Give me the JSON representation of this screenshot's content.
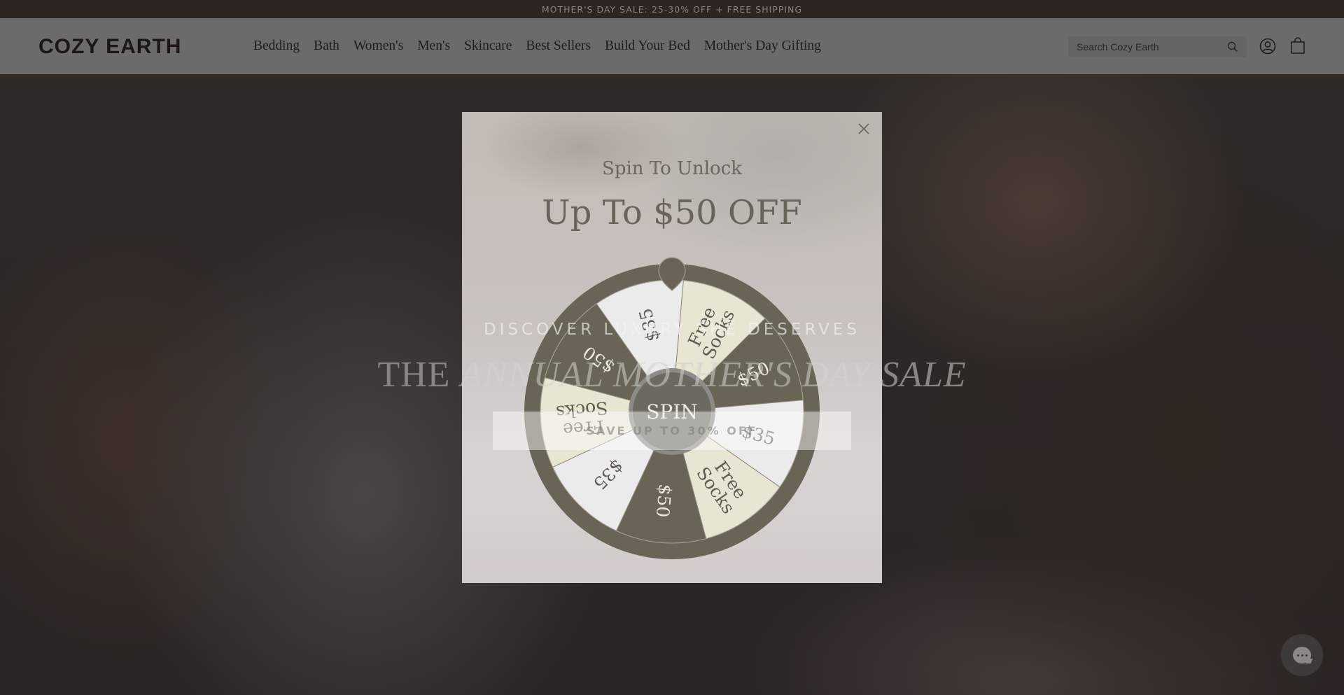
{
  "announcement": {
    "text": "MOTHER'S DAY SALE: 25-30% OFF  + FREE SHIPPING"
  },
  "header": {
    "logo": "COZY EARTH",
    "nav": [
      {
        "label": "Bedding"
      },
      {
        "label": "Bath"
      },
      {
        "label": "Women's"
      },
      {
        "label": "Men's"
      },
      {
        "label": "Skincare"
      },
      {
        "label": "Best Sellers"
      },
      {
        "label": "Build Your Bed"
      },
      {
        "label": "Mother's Day Gifting"
      }
    ],
    "search": {
      "placeholder": "Search Cozy Earth",
      "value": "",
      "icon": "search-icon"
    },
    "account_icon": "account-icon",
    "cart_icon": "cart-icon"
  },
  "hero": {
    "kicker": "DISCOVER LUXURY SHE DESERVES",
    "title_plain": "THE ",
    "title_italic": "ANNUAL MOTHER'S DAY SALE",
    "cta": "SAVE UP TO 30% OFF"
  },
  "modal": {
    "close_icon": "close-icon",
    "kicker": "Spin To Unlock",
    "title": "Up To $50 OFF",
    "wheel": {
      "spin_label": "SPIN",
      "segments": [
        {
          "label": "$35",
          "lines": [
            "$35"
          ],
          "color": "#ecebeb",
          "text_color": "#5f5a52"
        },
        {
          "label": "Free Socks",
          "lines": [
            "Free",
            "Socks"
          ],
          "color": "#e8e5d3",
          "text_color": "#5f5a52"
        },
        {
          "label": "$50",
          "lines": [
            "$50"
          ],
          "color": "#6a6457",
          "text_color": "#ece8df"
        },
        {
          "label": "$35",
          "lines": [
            "$35"
          ],
          "color": "#ecebeb",
          "text_color": "#5f5a52"
        },
        {
          "label": "Free Socks",
          "lines": [
            "Free",
            "Socks"
          ],
          "color": "#e8e5d3",
          "text_color": "#5f5a52"
        },
        {
          "label": "$50",
          "lines": [
            "$50"
          ],
          "color": "#6a6457",
          "text_color": "#ece8df"
        },
        {
          "label": "$35",
          "lines": [
            "$35"
          ],
          "color": "#ecebeb",
          "text_color": "#5f5a52"
        },
        {
          "label": "Free Socks",
          "lines": [
            "Free",
            "Socks"
          ],
          "color": "#e8e5d3",
          "text_color": "#5f5a52"
        },
        {
          "label": "$50",
          "lines": [
            "$50"
          ],
          "color": "#6a6457",
          "text_color": "#ece8df"
        }
      ],
      "rim_color": "#6a6457",
      "hub_color": "#6a6a60"
    }
  },
  "chat": {
    "icon": "chat-icon"
  }
}
